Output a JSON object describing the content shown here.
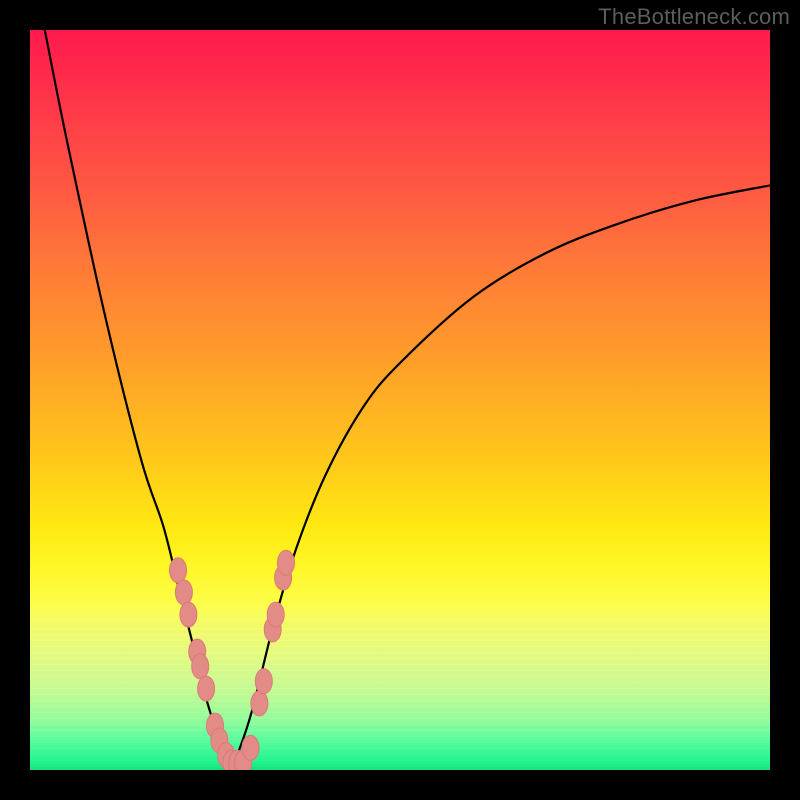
{
  "watermark": "TheBottleneck.com",
  "colors": {
    "frame": "#000000",
    "curve": "#000000",
    "marker_fill": "#e38b87",
    "marker_stroke": "#d87b76"
  },
  "chart_data": {
    "type": "line",
    "title": "",
    "xlabel": "",
    "ylabel": "",
    "xlim": [
      0,
      100
    ],
    "ylim": [
      0,
      100
    ],
    "grid": false,
    "note": "Bottleneck-style V-curve. x is a relative performance axis (0–100), y is estimated bottleneck percentage (0–100). The minimum (~0%) is near x≈27. Values read from the plot.",
    "series": [
      {
        "name": "bottleneck-curve",
        "x": [
          2,
          5,
          10,
          15,
          18,
          20,
          22,
          24,
          26,
          27,
          28,
          30,
          33,
          36,
          40,
          45,
          50,
          60,
          70,
          80,
          90,
          100
        ],
        "y": [
          100,
          85,
          62,
          42,
          33,
          25,
          17,
          9,
          3,
          0,
          2,
          8,
          20,
          30,
          40,
          49,
          55,
          64,
          70,
          74,
          77,
          79
        ]
      }
    ],
    "markers": {
      "name": "highlighted-points",
      "note": "Salmon oval markers clustered on both walls of the V near the bottom.",
      "points": [
        {
          "x": 20.0,
          "y": 27
        },
        {
          "x": 20.8,
          "y": 24
        },
        {
          "x": 21.4,
          "y": 21
        },
        {
          "x": 22.6,
          "y": 16
        },
        {
          "x": 23.0,
          "y": 14
        },
        {
          "x": 23.8,
          "y": 11
        },
        {
          "x": 25.0,
          "y": 6
        },
        {
          "x": 25.6,
          "y": 4
        },
        {
          "x": 26.5,
          "y": 2
        },
        {
          "x": 27.2,
          "y": 1
        },
        {
          "x": 28.0,
          "y": 1
        },
        {
          "x": 28.8,
          "y": 1
        },
        {
          "x": 29.8,
          "y": 3
        },
        {
          "x": 31.0,
          "y": 9
        },
        {
          "x": 31.6,
          "y": 12
        },
        {
          "x": 32.8,
          "y": 19
        },
        {
          "x": 33.2,
          "y": 21
        },
        {
          "x": 34.2,
          "y": 26
        },
        {
          "x": 34.6,
          "y": 28
        }
      ]
    }
  }
}
